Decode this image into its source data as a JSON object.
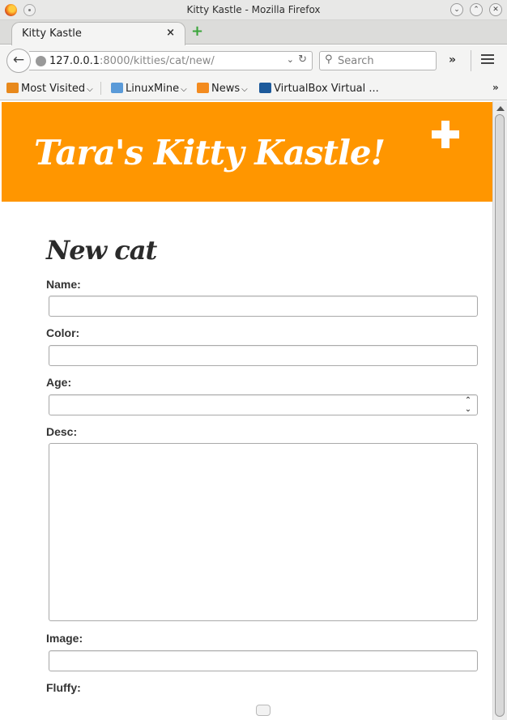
{
  "window": {
    "title": "Kitty Kastle - Mozilla Firefox"
  },
  "tab": {
    "label": "Kitty Kastle",
    "close": "×",
    "new_tab": "+"
  },
  "nav": {
    "back": "←",
    "url_host": "127.0.0.1",
    "url_rest": ":8000/kitties/cat/new/",
    "url_dropdown": "⌄",
    "reload": "↻",
    "search_icon": "search-icon",
    "search_placeholder": "Search",
    "overflow": "»"
  },
  "bookmarks": {
    "items": [
      {
        "label": "Most Visited",
        "icon": "most-visited-icon",
        "color": "#e8891c"
      },
      {
        "label": "LinuxMine",
        "icon": "folder-icon",
        "color": "#5a9ad8"
      },
      {
        "label": "News",
        "icon": "rss-feed-icon",
        "color": "#f38b1f"
      },
      {
        "label": "VirtualBox Virtual ...",
        "icon": "virtualbox-icon",
        "color": "#1d5a9b"
      }
    ],
    "more": "»"
  },
  "site": {
    "title": "Tara's Kitty Kastle!",
    "header_color": "#ff9600",
    "add_icon": "plus-icon"
  },
  "form": {
    "heading": "New cat",
    "name_label": "Name:",
    "name_value": "",
    "color_label": "Color:",
    "color_value": "",
    "age_label": "Age:",
    "age_value": "",
    "desc_label": "Desc:",
    "desc_value": "",
    "image_label": "Image:",
    "image_value": "",
    "fluffy_label": "Fluffy:"
  }
}
